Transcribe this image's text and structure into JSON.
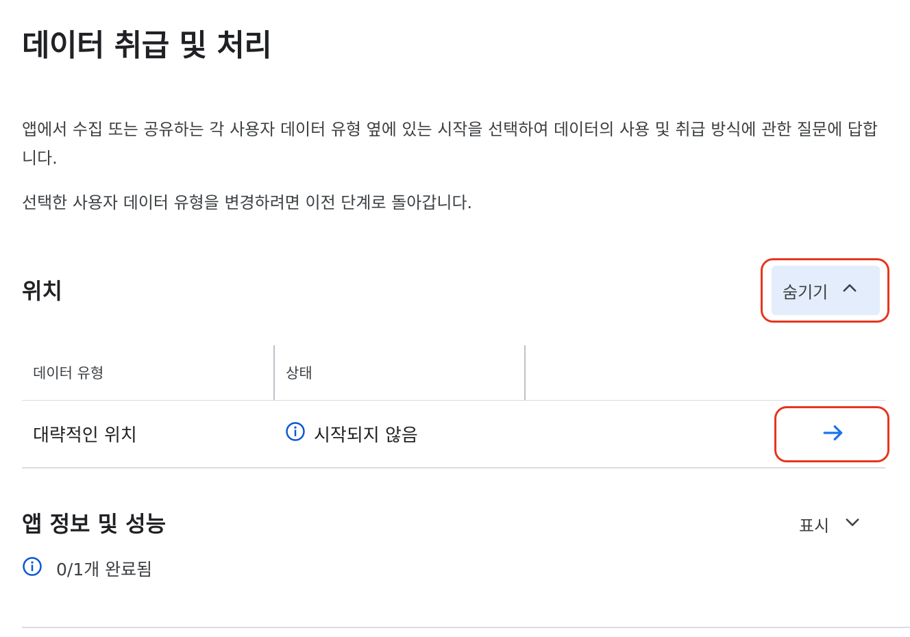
{
  "page": {
    "title": "데이터 취급 및 처리",
    "intro": "앱에서 수집 또는 공유하는 각 사용자 데이터 유형 옆에 있는 시작을 선택하여 데이터의 사용 및 취급 방식에 관한 질문에 답합니다.",
    "note": "선택한 사용자 데이터 유형을 변경하려면 이전 단계로 돌아갑니다."
  },
  "sections": [
    {
      "title": "위치",
      "toggle_label": "숨기기",
      "toggle_icon": "chevron-up-icon",
      "expanded": true,
      "table": {
        "columns": [
          "데이터 유형",
          "상태",
          ""
        ],
        "rows": [
          {
            "type": "대략적인 위치",
            "status": "시작되지 않음",
            "status_icon": "info-icon",
            "action_icon": "arrow-right-icon"
          }
        ]
      }
    },
    {
      "title": "앱 정보 및 성능",
      "toggle_label": "표시",
      "toggle_icon": "chevron-down-icon",
      "expanded": false,
      "progress_text": "0/1개 완료됨",
      "progress_icon": "info-icon"
    }
  ],
  "colors": {
    "accent": "#1a73e8",
    "info_icon": "#0b57d0",
    "toggle_bg": "#e3edfb",
    "highlight": "#e8341c"
  }
}
